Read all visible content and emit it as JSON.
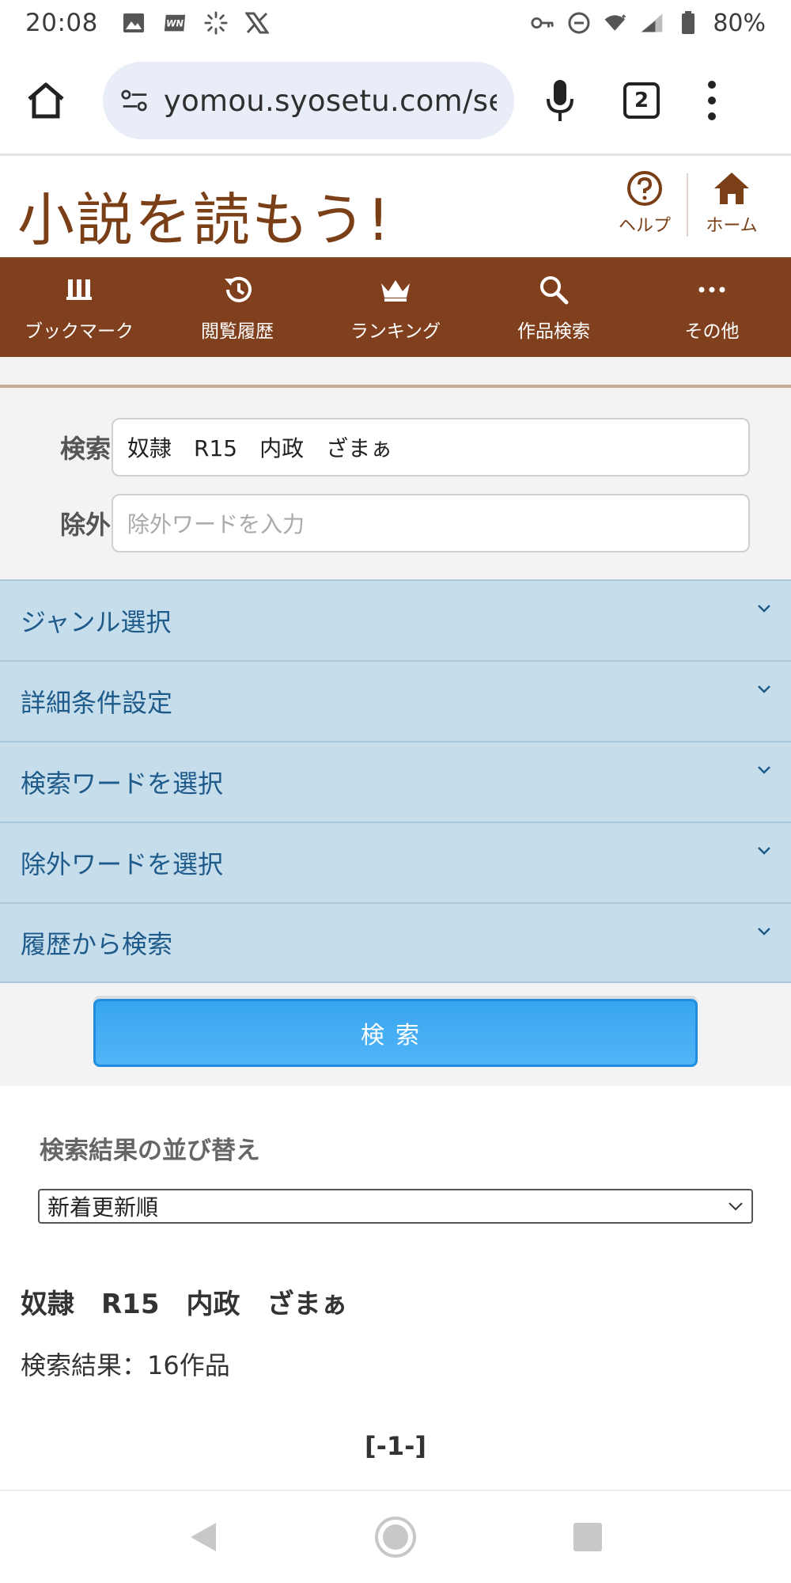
{
  "status_bar": {
    "time": "20:08",
    "battery": "80%",
    "left_icons": [
      "image-icon",
      "wn-app-icon",
      "loading-icon",
      "x-icon"
    ],
    "right_icons": [
      "key-icon",
      "dnd-icon",
      "wifi-icon",
      "signal-icon",
      "battery-icon"
    ]
  },
  "browser": {
    "url": "yomou.syosetu.com/sea",
    "tab_count": "2"
  },
  "site": {
    "logo_text": "小説を読もう!",
    "help_label": "ヘルプ",
    "home_label": "ホーム"
  },
  "nav": {
    "items": [
      {
        "label": "ブックマーク",
        "icon": "bookmark-icon"
      },
      {
        "label": "閲覧履歴",
        "icon": "history-icon"
      },
      {
        "label": "ランキング",
        "icon": "crown-icon"
      },
      {
        "label": "作品検索",
        "icon": "search-icon"
      },
      {
        "label": "その他",
        "icon": "more-icon"
      }
    ]
  },
  "search": {
    "keyword_label": "検索",
    "keyword_value": "奴隷　R15　内政　ざまぁ",
    "exclude_label": "除外",
    "exclude_placeholder": "除外ワードを入力",
    "submit_label": "検索"
  },
  "accordion": {
    "items": [
      "ジャンル選択",
      "詳細条件設定",
      "検索ワードを選択",
      "除外ワードを選択",
      "履歴から検索"
    ]
  },
  "results": {
    "sort_title": "検索結果の並び替え",
    "sort_selected": "新着更新順",
    "query_display": "奴隷　R15　内政　ざまぁ",
    "count_text": "検索結果：16作品",
    "pager": "[-1-]"
  },
  "colors": {
    "brand_brown": "#80401e",
    "accordion_bg": "#c6ddeb",
    "accordion_text": "#1e5a8a",
    "button_blue": "#38a6ef"
  }
}
